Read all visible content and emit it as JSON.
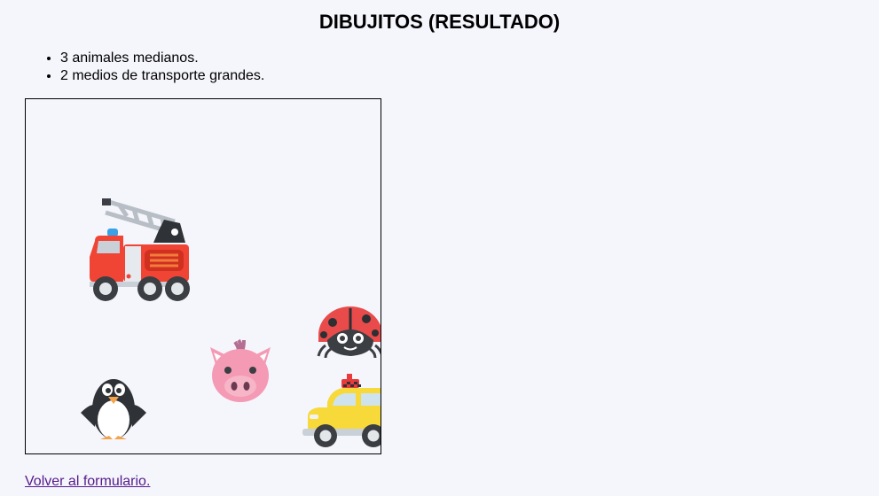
{
  "page": {
    "title": "DIBUJITOS (RESULTADO)",
    "summary": [
      "3 animales medianos.",
      "2 medios de transporte grandes."
    ],
    "back_link": "Volver al formulario."
  },
  "drawing": {
    "stickers": [
      {
        "icon": "fire-engine-icon",
        "category": "medio de transporte",
        "size": "grande"
      },
      {
        "icon": "ladybug-icon",
        "category": "animal",
        "size": "mediano"
      },
      {
        "icon": "pig-face-icon",
        "category": "animal",
        "size": "mediano"
      },
      {
        "icon": "penguin-icon",
        "category": "animal",
        "size": "mediano"
      },
      {
        "icon": "taxi-icon",
        "category": "medio de transporte",
        "size": "grande"
      }
    ]
  },
  "colors": {
    "background": "#f5f6fc",
    "link": "#551a8b",
    "border": "#000000"
  }
}
